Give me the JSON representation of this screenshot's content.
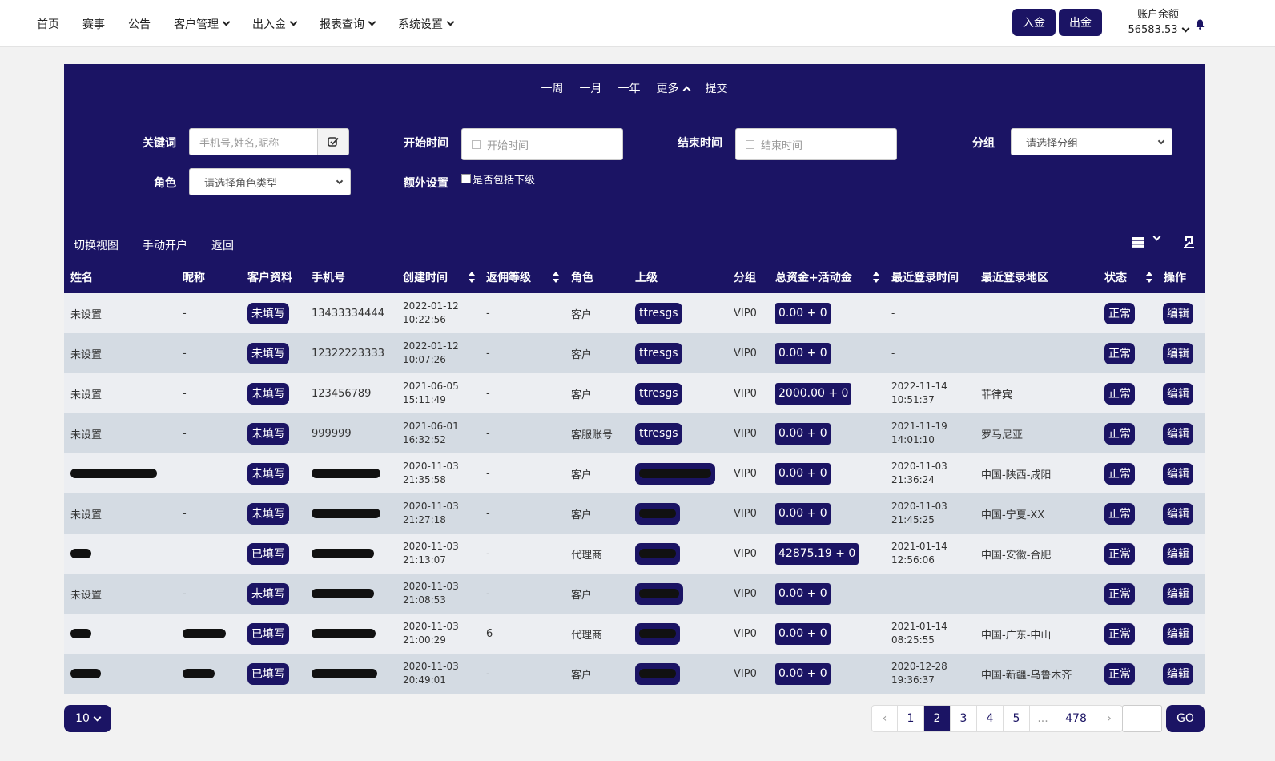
{
  "nav": {
    "items": [
      {
        "label": "首页",
        "has_dropdown": false
      },
      {
        "label": "赛事",
        "has_dropdown": false
      },
      {
        "label": "公告",
        "has_dropdown": false
      },
      {
        "label": "客户管理",
        "has_dropdown": true
      },
      {
        "label": "出入金",
        "has_dropdown": true
      },
      {
        "label": "报表查询",
        "has_dropdown": true
      },
      {
        "label": "系统设置",
        "has_dropdown": true
      }
    ],
    "deposit_label": "入金",
    "withdraw_label": "出金",
    "balance_label": "账户余额",
    "balance_value": "56583.53"
  },
  "filters": {
    "quick_ranges": [
      "一周",
      "一月",
      "一年",
      "更多",
      "提交"
    ],
    "keyword_label": "关键词",
    "keyword_placeholder": "手机号,姓名,昵称",
    "start_label": "开始时间",
    "start_placeholder": "开始时间",
    "end_label": "结束时间",
    "end_placeholder": "结束时间",
    "group_label": "分组",
    "group_value": "请选择分组",
    "role_label": "角色",
    "role_value": "请选择角色类型",
    "extra_label": "额外设置",
    "include_sub_label": "是否包括下级"
  },
  "toolbar": {
    "switch_view": "切换视图",
    "manual_open": "手动开户",
    "back": "返回"
  },
  "table": {
    "headers": {
      "name": "姓名",
      "nickname": "昵称",
      "profile": "客户资料",
      "phone": "手机号",
      "created": "创建时间",
      "rebate": "返佣等级",
      "role": "角色",
      "parent": "上级",
      "group": "分组",
      "funds": "总资金+活动金",
      "last_login": "最近登录时间",
      "last_region": "最近登录地区",
      "status": "状态",
      "action": "操作"
    },
    "rows": [
      {
        "name": "未设置",
        "nickname": "-",
        "profile": "未填写",
        "phone": "13433334444",
        "created_date": "2022-01-12",
        "created_time": "10:22:56",
        "rebate": "-",
        "role": "客户",
        "parent": "ttresgs",
        "group": "VIP0",
        "funds": "0.00 + 0",
        "login_date": "-",
        "login_time": "",
        "region": "",
        "status": "正常",
        "action": "编辑"
      },
      {
        "name": "未设置",
        "nickname": "-",
        "profile": "未填写",
        "phone": "12322223333",
        "created_date": "2022-01-12",
        "created_time": "10:07:26",
        "rebate": "-",
        "role": "客户",
        "parent": "ttresgs",
        "group": "VIP0",
        "funds": "0.00 + 0",
        "login_date": "-",
        "login_time": "",
        "region": "",
        "status": "正常",
        "action": "编辑"
      },
      {
        "name": "未设置",
        "nickname": "-",
        "profile": "未填写",
        "phone": "123456789",
        "created_date": "2021-06-05",
        "created_time": "15:11:49",
        "rebate": "-",
        "role": "客户",
        "parent": "ttresgs",
        "group": "VIP0",
        "funds": "2000.00 + 0",
        "login_date": "2022-11-14",
        "login_time": "10:51:37",
        "region": "菲律宾",
        "status": "正常",
        "action": "编辑"
      },
      {
        "name": "未设置",
        "nickname": "-",
        "profile": "未填写",
        "phone": "999999",
        "created_date": "2021-06-01",
        "created_time": "16:32:52",
        "rebate": "-",
        "role": "客服账号",
        "parent": "ttresgs",
        "group": "VIP0",
        "funds": "0.00 + 0",
        "login_date": "2021-11-19",
        "login_time": "14:01:10",
        "region": "罗马尼亚",
        "status": "正常",
        "action": "编辑"
      },
      {
        "name": "",
        "nickname": "",
        "profile": "未填写",
        "phone": "",
        "created_date": "2020-11-03",
        "created_time": "21:35:58",
        "rebate": "-",
        "role": "客户",
        "parent": "",
        "group": "VIP0",
        "funds": "0.00 + 0",
        "login_date": "2020-11-03",
        "login_time": "21:36:24",
        "region": "中国-陕西-咸阳",
        "status": "正常",
        "action": "编辑"
      },
      {
        "name": "未设置",
        "nickname": "-",
        "profile": "未填写",
        "phone": "",
        "created_date": "2020-11-03",
        "created_time": "21:27:18",
        "rebate": "-",
        "role": "客户",
        "parent": "",
        "group": "VIP0",
        "funds": "0.00 + 0",
        "login_date": "2020-11-03",
        "login_time": "21:45:25",
        "region": "中国-宁夏-XX",
        "status": "正常",
        "action": "编辑"
      },
      {
        "name": "",
        "nickname": "",
        "profile": "已填写",
        "phone": "",
        "created_date": "2020-11-03",
        "created_time": "21:13:07",
        "rebate": "-",
        "role": "代理商",
        "parent": "",
        "group": "VIP0",
        "funds": "42875.19 + 0",
        "login_date": "2021-01-14",
        "login_time": "12:56:06",
        "region": "中国-安徽-合肥",
        "status": "正常",
        "action": "编辑"
      },
      {
        "name": "未设置",
        "nickname": "-",
        "profile": "未填写",
        "phone": "",
        "created_date": "2020-11-03",
        "created_time": "21:08:53",
        "rebate": "-",
        "role": "客户",
        "parent": "",
        "group": "VIP0",
        "funds": "0.00 + 0",
        "login_date": "-",
        "login_time": "",
        "region": "",
        "status": "正常",
        "action": "编辑"
      },
      {
        "name": "",
        "nickname": "",
        "profile": "已填写",
        "phone": "",
        "created_date": "2020-11-03",
        "created_time": "21:00:29",
        "rebate": "6",
        "role": "代理商",
        "parent": "",
        "group": "VIP0",
        "funds": "0.00 + 0",
        "login_date": "2021-01-14",
        "login_time": "08:25:55",
        "region": "中国-广东-中山",
        "status": "正常",
        "action": "编辑"
      },
      {
        "name": "",
        "nickname": "",
        "profile": "已填写",
        "phone": "",
        "created_date": "2020-11-03",
        "created_time": "20:49:01",
        "rebate": "-",
        "role": "客户",
        "parent": "",
        "group": "VIP0",
        "funds": "0.00 + 0",
        "login_date": "2020-12-28",
        "login_time": "19:36:37",
        "region": "中国-新疆-乌鲁木齐",
        "status": "正常",
        "action": "编辑"
      }
    ]
  },
  "footer": {
    "page_size": "10",
    "pages": [
      "‹",
      "1",
      "2",
      "3",
      "4",
      "5",
      "...",
      "478",
      "›"
    ],
    "active_page": "2",
    "go_label": "GO"
  }
}
